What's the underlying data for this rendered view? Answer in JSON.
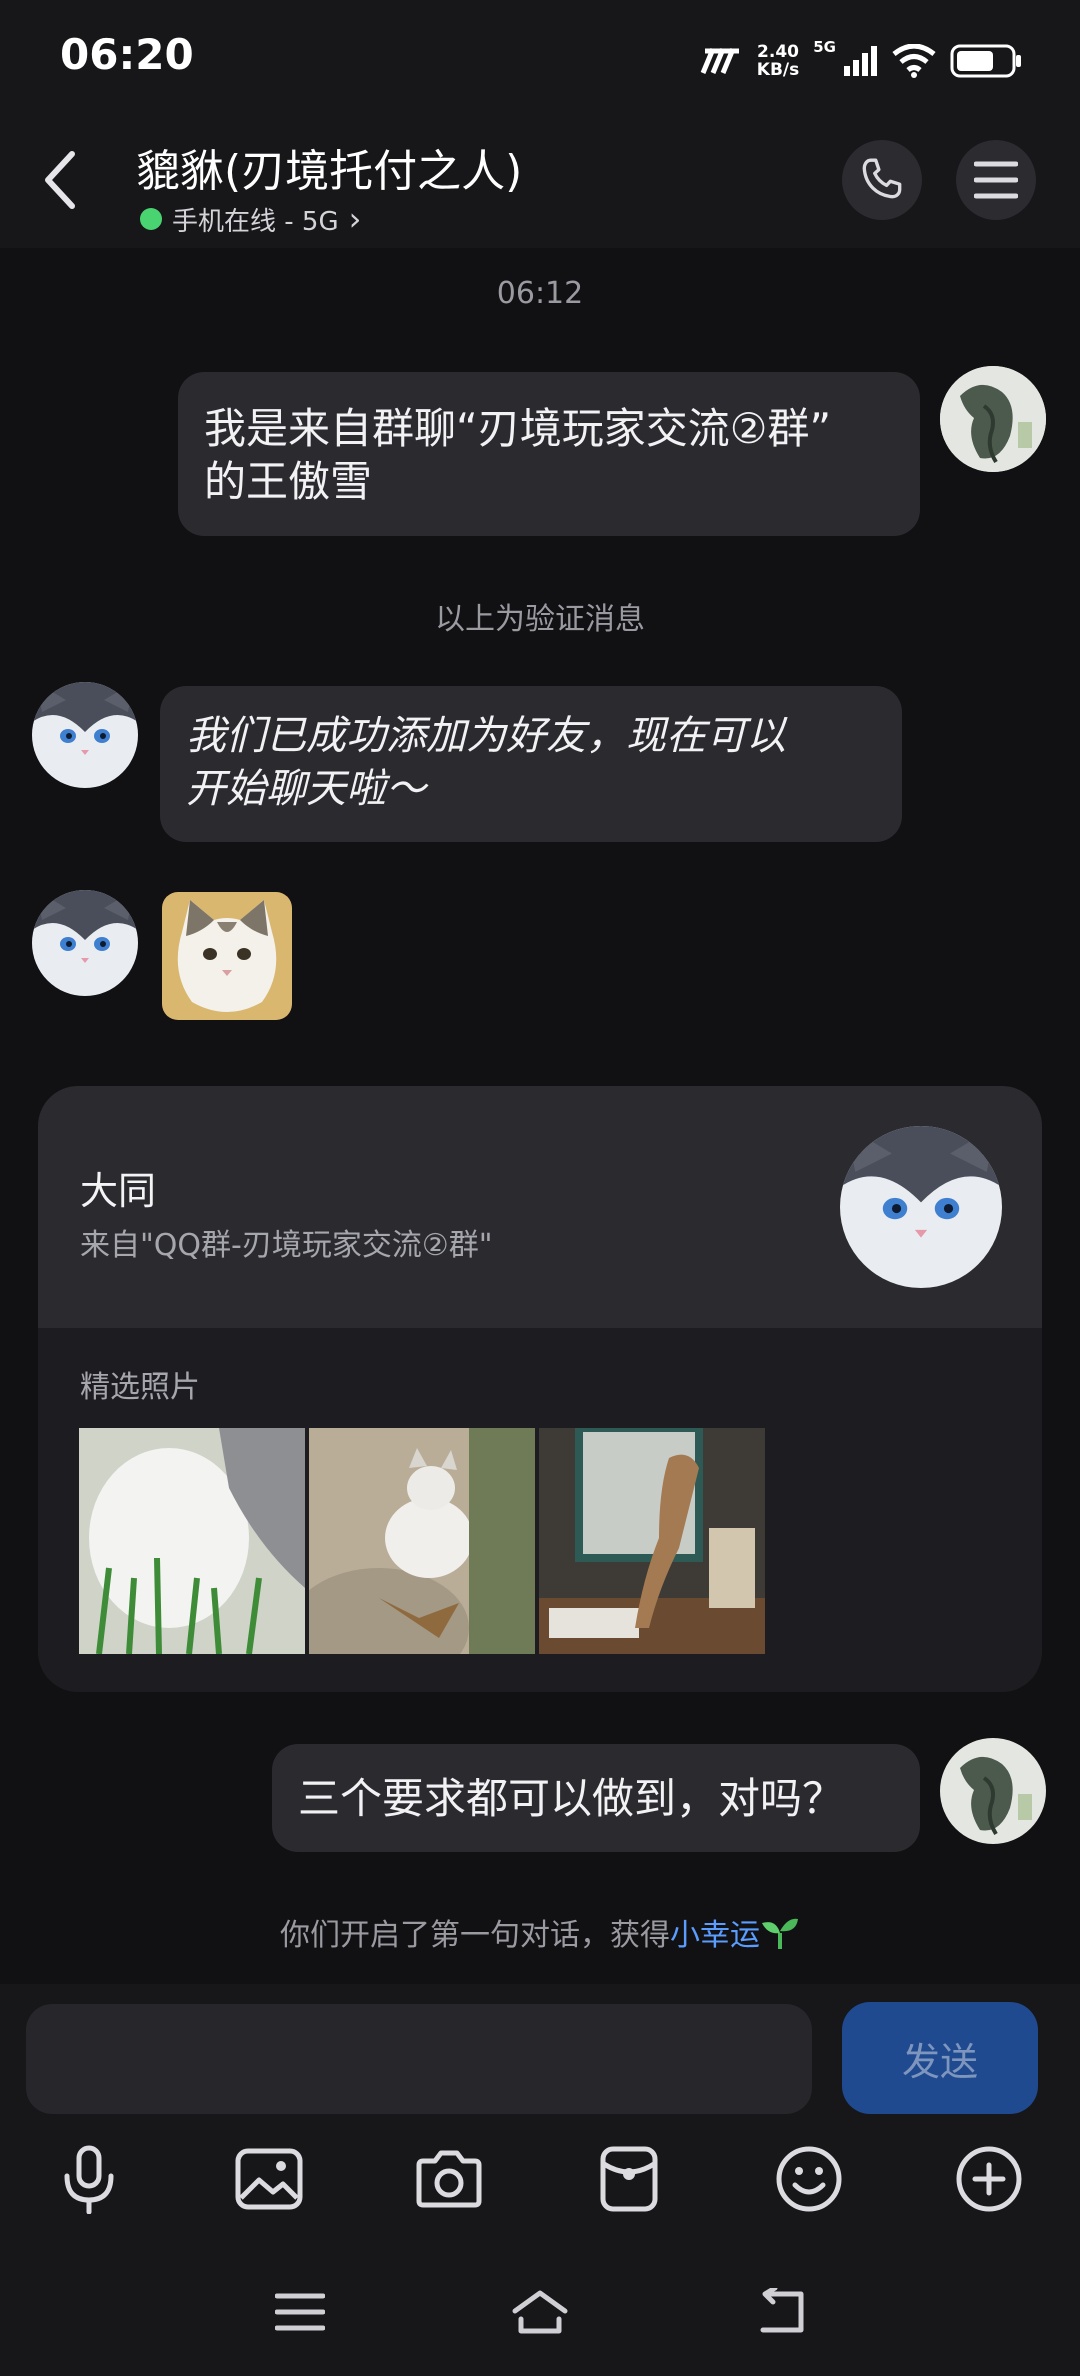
{
  "status_bar": {
    "time": "06:20",
    "net_speed_value": "2.40",
    "net_speed_unit": "KB/s",
    "network_type": "5G"
  },
  "header": {
    "title": "貔貅(刃境托付之人)",
    "status_text": "手机在线 - 5G",
    "status_chevron": "›"
  },
  "chat": {
    "timestamp": "06:12",
    "outgoing_1_line1": "我是来自群聊“刃境玩家交流②群”",
    "outgoing_1_line2": "的王傲雪",
    "verify_note": "以上为验证消息",
    "incoming_1_line1": "我们已成功添加为好友，现在可以",
    "incoming_1_line2": "开始聊天啦～",
    "outgoing_2": "三个要求都可以做到，对吗？",
    "system_note_prefix": "你们开启了第一句对话，获得",
    "system_note_link": "小幸运"
  },
  "card": {
    "name": "大同",
    "source": "来自\"QQ群-刃境玩家交流②群\"",
    "photos_label": "精选照片"
  },
  "input": {
    "placeholder": "",
    "send_label": "发送"
  },
  "toolbar_icons": [
    "mic-icon",
    "image-icon",
    "camera-icon",
    "red-packet-icon",
    "emoji-icon",
    "plus-icon"
  ],
  "colors": {
    "accent_link": "#5b9cff",
    "online": "#4ad371",
    "send_button": "#1f4a8f"
  }
}
